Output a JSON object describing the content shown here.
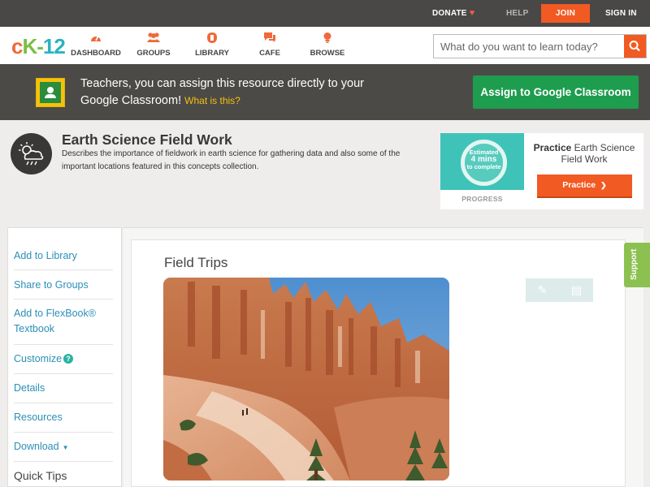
{
  "topbar": {
    "donate": "DONATE",
    "help": "HELP",
    "join": "JOIN",
    "signin": "SIGN IN"
  },
  "nav": {
    "logo_c": "c",
    "logo_k": "K",
    "logo_dash": "-",
    "logo_num": "12",
    "items": [
      {
        "label": "DASHBOARD",
        "icon": "dashboard-icon"
      },
      {
        "label": "GROUPS",
        "icon": "groups-icon"
      },
      {
        "label": "LIBRARY",
        "icon": "library-icon"
      },
      {
        "label": "CAFE",
        "icon": "cafe-icon"
      },
      {
        "label": "BROWSE",
        "icon": "browse-icon"
      }
    ],
    "search_placeholder": "What do you want to learn today?"
  },
  "banner": {
    "text": "Teachers, you can assign this resource directly to your Google Classroom!",
    "what_link": "What is this?",
    "assign_button": "Assign to Google Classroom"
  },
  "concept": {
    "title": "Earth Science Field Work",
    "description": "Describes the importance of fieldwork in earth science for gathering data and also some of the important locations featured in this concepts collection."
  },
  "practice_card": {
    "estimated": "Estimated",
    "minutes": "4 mins",
    "to_complete": "to complete",
    "progress_label": "PROGRESS",
    "title_bold": "Practice",
    "title_rest": "Earth Science Field Work",
    "button": "Practice"
  },
  "sidebar": {
    "items": [
      {
        "label": "Add to Library"
      },
      {
        "label": "Share to Groups"
      },
      {
        "label": "Add to FlexBook® Textbook"
      },
      {
        "label": "Customize"
      },
      {
        "label": "Details"
      },
      {
        "label": "Resources"
      },
      {
        "label": "Download"
      }
    ],
    "quick_tips": "Quick Tips"
  },
  "main": {
    "section_title": "Field Trips"
  },
  "support": {
    "label": "Support"
  },
  "colors": {
    "accent_orange": "#f15a22",
    "google_green": "#1e9d4f",
    "link_blue": "#2b8fb8",
    "support_green": "#8cc152",
    "progress_teal": "#3fc3b8"
  }
}
